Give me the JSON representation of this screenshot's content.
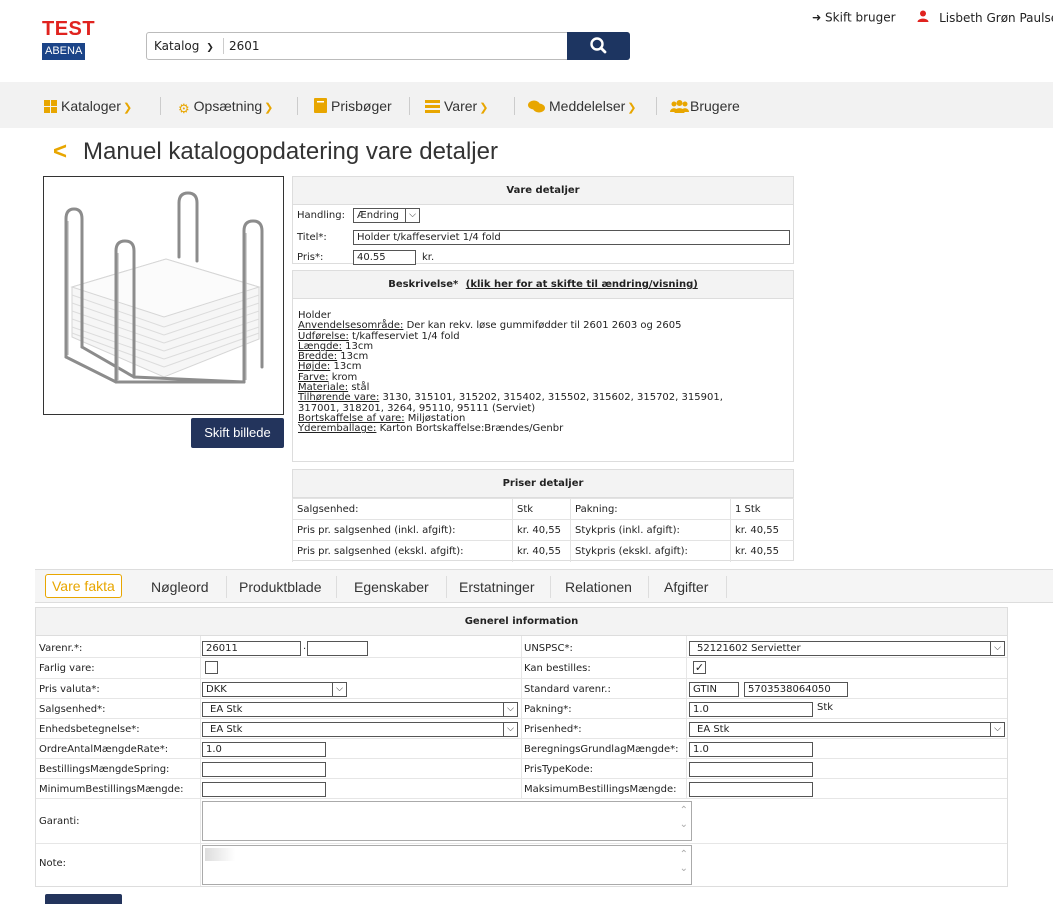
{
  "header": {
    "logo_top": "TEST",
    "logo_bottom": "ABENA",
    "search": {
      "category": "Katalog",
      "value": "2601"
    },
    "switch_user": "Skift bruger",
    "user_name": "Lisbeth Grøn Paulse"
  },
  "nav": [
    {
      "label": "Kataloger",
      "icon": "grid-icon"
    },
    {
      "label": "Opsætning",
      "icon": "gear-icon"
    },
    {
      "label": "Prisbøger",
      "icon": "book-icon"
    },
    {
      "label": "Varer",
      "icon": "list-icon"
    },
    {
      "label": "Meddelelser",
      "icon": "chat-icon"
    },
    {
      "label": "Brugere",
      "icon": "users-icon"
    }
  ],
  "page_title": "Manuel katalogopdatering vare detaljer",
  "change_image_button": "Skift billede",
  "vare_detaljer": {
    "heading": "Vare detaljer",
    "handling_label": "Handling:",
    "handling_value": "Ændring",
    "titel_label": "Titel*:",
    "titel_value": "Holder t/kaffeserviet 1/4 fold",
    "pris_label": "Pris*:",
    "pris_value": "40.55",
    "pris_unit": "kr."
  },
  "beskrivelse": {
    "heading": "Beskrivelse*",
    "toggle_link": "(klik her for at skifte til ændring/visning)",
    "intro": "Holder",
    "lines": [
      {
        "key": "Anvendelsesområde:",
        "value": " Der kan rekv. løse gummifødder til 2601 2603 og 2605"
      },
      {
        "key": "Udførelse:",
        "value": " t/kaffeserviet 1/4 fold"
      },
      {
        "key": "Længde:",
        "value": " 13cm"
      },
      {
        "key": "Bredde:",
        "value": " 13cm"
      },
      {
        "key": "Højde:",
        "value": " 13cm"
      },
      {
        "key": "Farve:",
        "value": " krom"
      },
      {
        "key": "Materiale:",
        "value": " stål"
      },
      {
        "key": "Tilhørende vare:",
        "value": " 3130, 315101, 315202, 315402, 315502, 315602, 315702, 315901,"
      },
      {
        "key": "",
        "value": "317001, 318201, 3264, 95110, 95111 (Serviet)"
      },
      {
        "key": "Bortskaffelse af vare:",
        "value": " Miljøstation"
      },
      {
        "key": "Yderemballage:",
        "value": " Karton Bortskaffelse:Brændes/Genbr"
      }
    ]
  },
  "priser": {
    "heading": "Priser detaljer",
    "rows": [
      [
        "Salgsenhed:",
        "Stk",
        "Pakning:",
        "1 Stk"
      ],
      [
        "Pris pr. salgsenhed (inkl. afgift):",
        "kr. 40,55",
        "Stykpris (inkl. afgift):",
        "kr. 40,55"
      ],
      [
        "Pris pr. salgsenhed (ekskl. afgift):",
        "kr. 40,55",
        "Stykpris (ekskl. afgift):",
        "kr. 40,55"
      ]
    ]
  },
  "tabs": [
    "Vare fakta",
    "Nøgleord",
    "Produktblade",
    "Egenskaber",
    "Erstatninger",
    "Relationen",
    "Afgifter"
  ],
  "generel": {
    "heading": "Generel information",
    "varenr_label": "Varenr.*:",
    "varenr_value": "26011",
    "varenr_dot": ".",
    "unspsc_label": "UNSPSC*:",
    "unspsc_value": "52121602 Servietter",
    "farlig_label": "Farlig vare:",
    "farlig_checked": false,
    "kan_bestilles_label": "Kan bestilles:",
    "kan_bestilles_checked": true,
    "pris_valuta_label": "Pris valuta*:",
    "pris_valuta_value": "DKK",
    "standard_varenr_label": "Standard varenr.:",
    "standard_type": "GTIN",
    "standard_value": "5703538064050",
    "salgsenhed_label": "Salgsenhed*:",
    "salgsenhed_value": "EA Stk",
    "pakning_label": "Pakning*:",
    "pakning_value": "1.0",
    "pakning_unit": "Stk",
    "enhedsbetegnelse_label": "Enhedsbetegnelse*:",
    "enhedsbetegnelse_value": "EA Stk",
    "prisenhed_label": "Prisenhed*:",
    "prisenhed_value": "EA Stk",
    "ordreantal_label": "OrdreAntalMængdeRate*:",
    "ordreantal_value": "1.0",
    "beregning_label": "BeregningsGrundlagMængde*:",
    "beregning_value": "1.0",
    "bestillingspring_label": "BestillingsMængdeSpring:",
    "bestillingspring_value": "",
    "pristypekode_label": "PrisTypeKode:",
    "pristypekode_value": "",
    "minimum_label": "MinimumBestillingsMængde:",
    "minimum_value": "",
    "maksimum_label": "MaksimumBestillingsMængde:",
    "maksimum_value": "",
    "garanti_label": "Garanti:",
    "note_label": "Note:"
  }
}
